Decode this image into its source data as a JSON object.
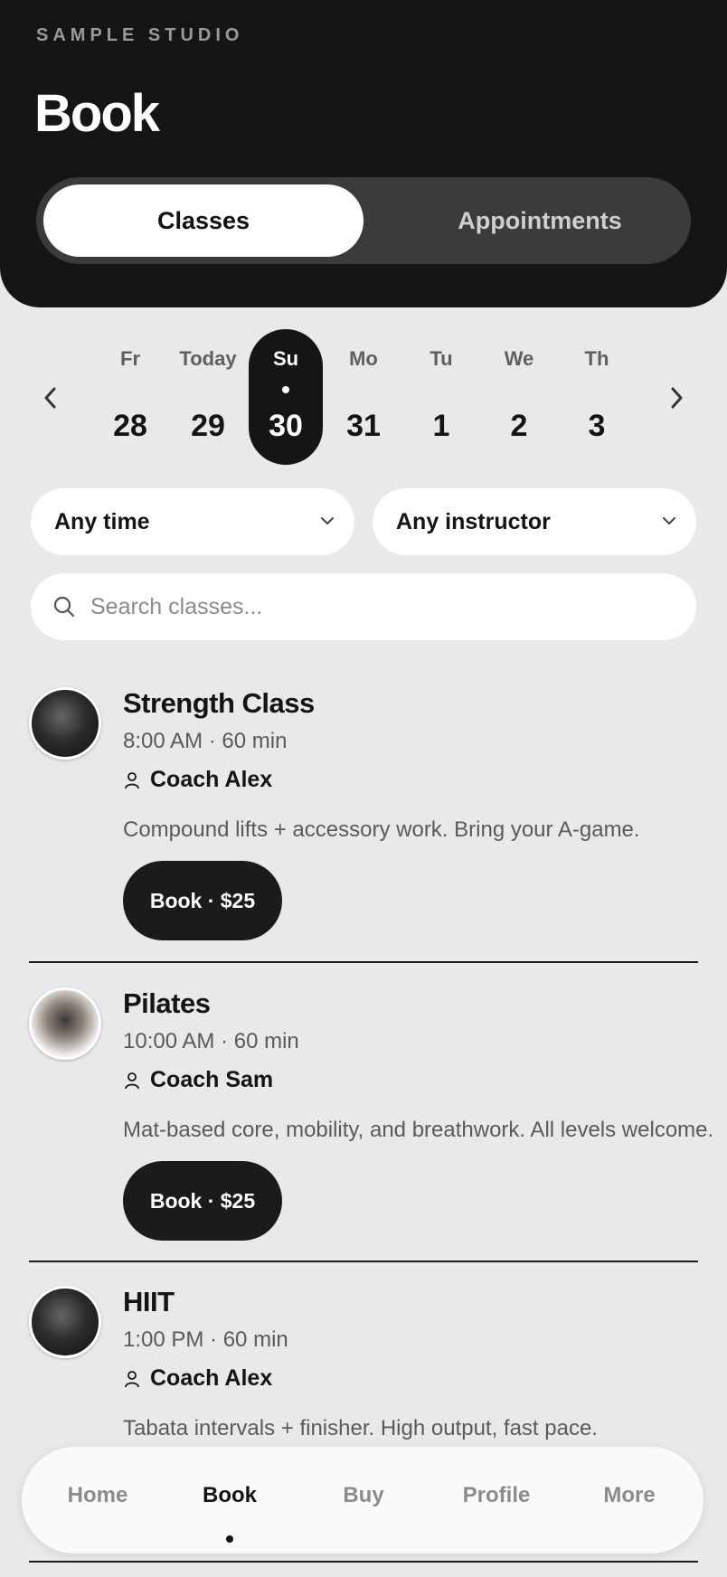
{
  "header": {
    "studio_name": "SAMPLE STUDIO",
    "title": "Book",
    "segments": [
      {
        "label": "Classes",
        "active": true
      },
      {
        "label": "Appointments",
        "active": false
      }
    ]
  },
  "dates": [
    {
      "name": "Fr",
      "number": "28"
    },
    {
      "name": "Today",
      "number": "29"
    },
    {
      "name": "Su",
      "number": "30",
      "selected": true
    },
    {
      "name": "Mo",
      "number": "31"
    },
    {
      "name": "Tu",
      "number": "1"
    },
    {
      "name": "We",
      "number": "2"
    },
    {
      "name": "Th",
      "number": "3"
    }
  ],
  "filters": {
    "time": "Any time",
    "instructor": "Any instructor"
  },
  "search": {
    "placeholder": "Search classes..."
  },
  "classes": [
    {
      "name": "Strength Class",
      "time": "8:00 AM · 60 min",
      "coach": "Coach Alex",
      "description": "Compound lifts + accessory work. Bring your A-game.",
      "book_label": "Book · $25"
    },
    {
      "name": "Pilates",
      "time": "10:00 AM · 60 min",
      "coach": "Coach Sam",
      "description": "Mat-based core, mobility, and breathwork. All levels welcome.",
      "book_label": "Book · $25"
    },
    {
      "name": "HIIT",
      "time": "1:00 PM · 60 min",
      "coach": "Coach Alex",
      "description": "Tabata intervals + finisher. High output, fast pace."
    }
  ],
  "nav": [
    {
      "label": "Home"
    },
    {
      "label": "Book",
      "active": true
    },
    {
      "label": "Buy"
    },
    {
      "label": "Profile"
    },
    {
      "label": "More"
    }
  ],
  "icons": {
    "prev": "chevron-left-icon",
    "next": "chevron-right-icon",
    "dropdown": "chevron-down-icon",
    "search": "search-icon",
    "coach": "person-icon"
  },
  "colors": {
    "header_bg": "#151515",
    "page_bg": "#e9e9ec",
    "accent": "#1b1b1b"
  }
}
